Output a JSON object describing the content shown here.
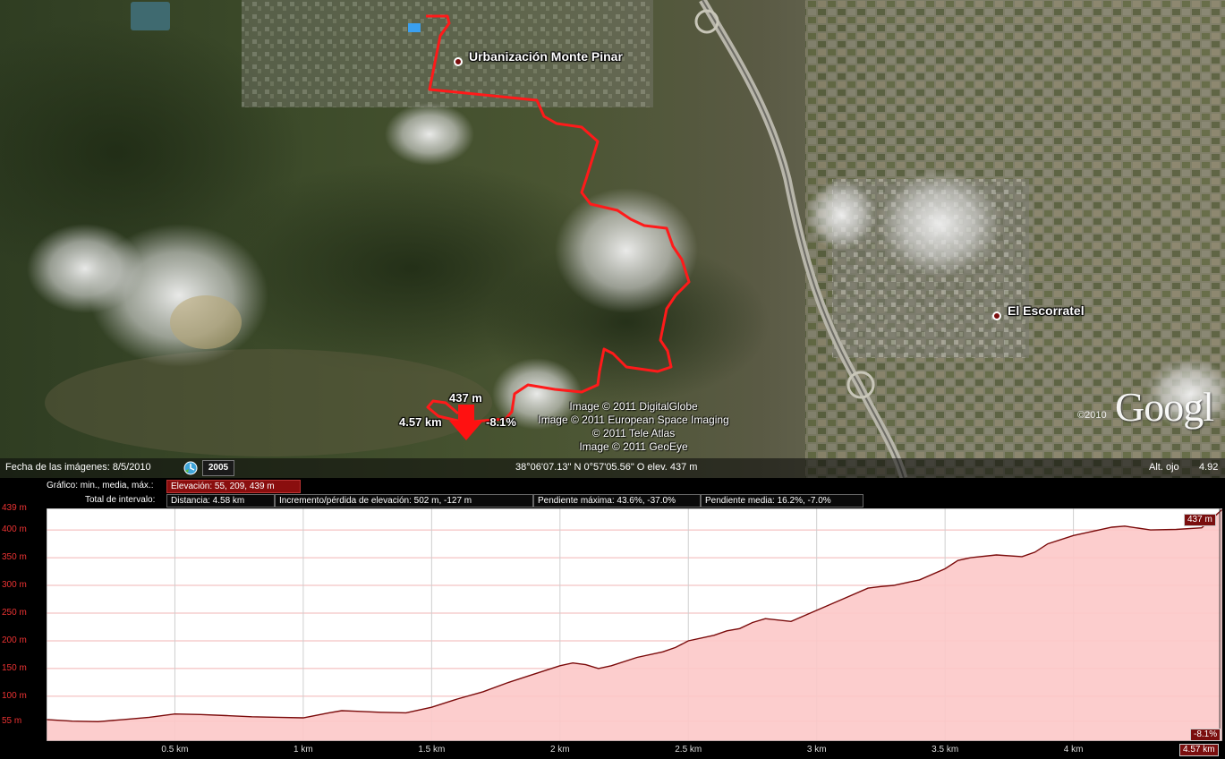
{
  "map": {
    "places": [
      {
        "name": "Urbanización Monte Pinar"
      },
      {
        "name": "El Escorratel"
      }
    ],
    "route_marker": {
      "elevation": "437 m",
      "distance": "4.57 km",
      "slope": "-8.1%"
    },
    "attribution": [
      "Image © 2011 DigitalGlobe",
      "Image © 2011 European Space Imaging",
      "© 2011 Tele Atlas",
      "Image © 2011 GeoEye"
    ],
    "logo_text": "Googl",
    "logo_year": "©2010",
    "colors": {
      "route": "#ff1a1a",
      "pin": "#7a0e0e"
    }
  },
  "statusbar": {
    "imagery_date": "Fecha de las imágenes: 8/5/2010",
    "historical_year": "2005",
    "coordinates": "38°06'07.13\" N    0°57'05.56\" O  elev.   437 m",
    "eye_alt_label": "Alt. ojo",
    "eye_alt_value": "4.92"
  },
  "profile": {
    "graph_label": "Gráfico: min., media, máx.:",
    "elevation_stats": "Elevación: 55, 209, 439 m",
    "interval_label": "Total de intervalo:",
    "distance": "Distancia: 4.58 km",
    "gain_loss": "Incremento/pérdida de elevación: 502 m, -127 m",
    "max_slope": "Pendiente máxima: 43.6%, -37.0%",
    "avg_slope": "Pendiente media: 16.2%, -7.0%",
    "cursor_elev": "437 m",
    "cursor_slope": "-8.1%",
    "cursor_dist": "4.57 km",
    "colors": {
      "fill": "#fcc8c8",
      "line": "#7a0a0a",
      "grid": "#cfcfcf",
      "tick": "#e33"
    }
  },
  "chart_data": {
    "type": "area",
    "title": "",
    "xlabel": "",
    "ylabel": "",
    "x_tick_labels": [
      "0.5 km",
      "1 km",
      "1.5 km",
      "2 km",
      "2.5 km",
      "3 km",
      "3.5 km",
      "4 km"
    ],
    "x_ticks": [
      0.5,
      1,
      1.5,
      2,
      2.5,
      3,
      3.5,
      4
    ],
    "y_tick_labels": [
      "439 m",
      "400 m",
      "350 m",
      "300 m",
      "250 m",
      "200 m",
      "150 m",
      "100 m",
      "55 m"
    ],
    "y_ticks": [
      439,
      400,
      350,
      300,
      250,
      200,
      150,
      100,
      55
    ],
    "xlim": [
      0,
      4.58
    ],
    "ylim": [
      19,
      439
    ],
    "grid": true,
    "series": [
      {
        "x": [
          0,
          0.1,
          0.2,
          0.3,
          0.4,
          0.5,
          0.6,
          0.7,
          0.8,
          0.9,
          1.0,
          1.1,
          1.15,
          1.2,
          1.3,
          1.4,
          1.5,
          1.6,
          1.7,
          1.8,
          1.9,
          2.0,
          2.05,
          2.1,
          2.15,
          2.2,
          2.3,
          2.4,
          2.45,
          2.5,
          2.6,
          2.65,
          2.7,
          2.75,
          2.8,
          2.9,
          3.0,
          3.1,
          3.2,
          3.25,
          3.3,
          3.4,
          3.5,
          3.55,
          3.6,
          3.7,
          3.8,
          3.85,
          3.9,
          4.0,
          4.1,
          4.15,
          4.2,
          4.3,
          4.4,
          4.5,
          4.58
        ],
        "y": [
          58,
          55,
          54,
          58,
          62,
          68,
          67,
          65,
          63,
          62,
          61,
          70,
          74,
          73,
          71,
          70,
          80,
          95,
          108,
          125,
          140,
          155,
          160,
          157,
          150,
          155,
          170,
          180,
          188,
          200,
          210,
          218,
          222,
          233,
          240,
          235,
          255,
          275,
          295,
          298,
          300,
          310,
          330,
          345,
          350,
          355,
          352,
          360,
          375,
          390,
          400,
          405,
          407,
          400,
          401,
          404,
          437
        ]
      }
    ]
  }
}
